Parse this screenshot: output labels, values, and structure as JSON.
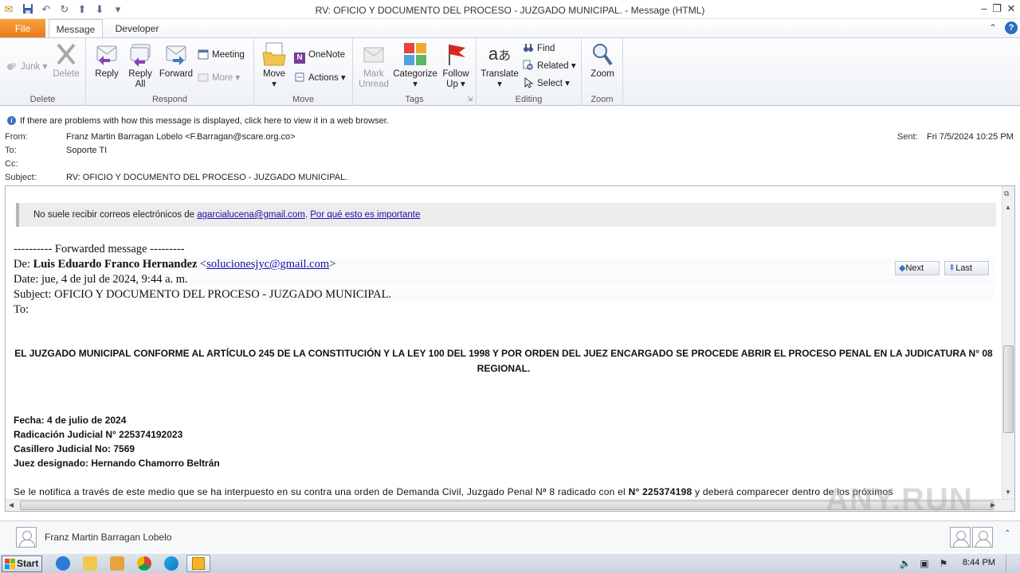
{
  "window": {
    "title": "RV: OFICIO Y DOCUMENTO DEL PROCESO - JUZGADO MUNICIPAL. - Message (HTML)"
  },
  "tabs": [
    {
      "label": "File"
    },
    {
      "label": "Message"
    },
    {
      "label": "Developer"
    }
  ],
  "ribbon": {
    "delete_group": {
      "label": "Delete",
      "junk": "Junk",
      "delete": "Delete"
    },
    "respond_group": {
      "label": "Respond",
      "reply": "Reply",
      "reply_all_1": "Reply",
      "reply_all_2": "All",
      "forward": "Forward",
      "meeting": "Meeting",
      "more": "More"
    },
    "move_group": {
      "label": "Move",
      "move": "Move",
      "onenote": "OneNote",
      "actions": "Actions"
    },
    "tags_group": {
      "label": "Tags",
      "mark_unread_1": "Mark",
      "mark_unread_2": "Unread",
      "categorize": "Categorize",
      "follow_up_1": "Follow",
      "follow_up_2": "Up"
    },
    "editing_group": {
      "label": "Editing",
      "translate": "Translate",
      "find": "Find",
      "related": "Related",
      "select": "Select"
    },
    "zoom_group": {
      "label": "Zoom",
      "zoom": "Zoom"
    }
  },
  "infobar": {
    "text": "If there are problems with how this message is displayed, click here to view it in a web browser."
  },
  "headers": {
    "from_label": "From:",
    "from_value": "Franz Martin Barragan Lobelo <F.Barragan@scare.org.co>",
    "to_label": "To:",
    "to_value": "Soporte TI",
    "cc_label": "Cc:",
    "subject_label": "Subject:",
    "subject_value": "RV: OFICIO Y DOCUMENTO DEL PROCESO - JUZGADO MUNICIPAL.",
    "sent_label": "Sent:",
    "sent_value": "Fri 7/5/2024 10:25 PM"
  },
  "message": {
    "warning_prefix": "No suele recibir correos electrónicos de ",
    "warning_email": "agarcialucena@gmail.com",
    "warning_link": "Por qué esto es importante",
    "forward_header": "---------- Forwarded message ---------",
    "fwd_from_label": "De: ",
    "fwd_from_name": "Luis Eduardo Franco Hernandez",
    "fwd_from_lt": " <",
    "fwd_from_email": "solucionesjyc@gmail.com",
    "fwd_from_gt": ">",
    "fwd_date": "Date: jue, 4 de jul de 2024, 9:44 a. m.",
    "fwd_subject": "Subject: OFICIO Y DOCUMENTO DEL PROCESO - JUZGADO MUNICIPAL.",
    "fwd_to": "To:",
    "next_label": "Next",
    "last_label": "Last",
    "heading_line1": "EL JUZGADO MUNICIPAL CONFORME AL ARTÍCULO 245 DE LA CONSTITUCIÓN Y LA LEY 100 DEL 1998 Y POR ORDEN DEL JUEZ ENCARGADO SE PROCEDE ABRIR EL PROCESO PENAL EN LA JUDICATURA N° 08",
    "heading_line2": "REGIONAL.",
    "fecha": "Fecha: 4 de julio de 2024",
    "radicacion": "Radicación Judicial N° 225374192023",
    "casillero": "Casillero Judicial No: 7569",
    "juez": "Juez designado: Hernando Chamorro Beltrán",
    "notice_a": "Se le notifica a través de este medio que se ha interpuesto en su contra una orden de Demanda Civil, Juzgado Penal Nª 8 radicado con el ",
    "notice_b": "N° 225374198",
    "notice_c": " y deberá comparecer dentro de los próximos"
  },
  "people_pane": {
    "name": "Franz Martin Barragan Lobelo"
  },
  "taskbar": {
    "start": "Start",
    "clock": "8:44 PM"
  },
  "watermark": "ANY.RUN",
  "colors": {
    "file_tab": "#e8791a",
    "link": "#1a0dab",
    "ribbon_bg": "#eef1f6"
  }
}
